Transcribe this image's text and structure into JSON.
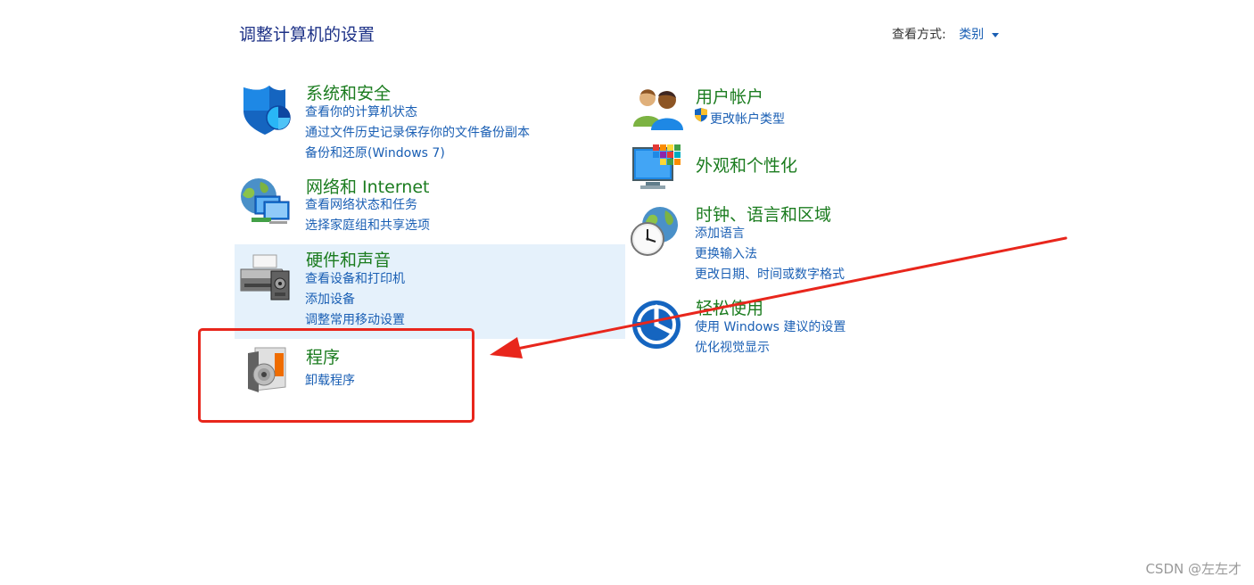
{
  "header": {
    "title": "调整计算机的设置",
    "view_by_label": "查看方式:",
    "view_by_value": "类别"
  },
  "categories": {
    "system_security": {
      "title": "系统和安全",
      "links": [
        "查看你的计算机状态",
        "通过文件历史记录保存你的文件备份副本",
        "备份和还原(Windows 7)"
      ]
    },
    "network": {
      "title": "网络和 Internet",
      "links": [
        "查看网络状态和任务",
        "选择家庭组和共享选项"
      ]
    },
    "hardware": {
      "title": "硬件和声音",
      "links": [
        "查看设备和打印机",
        "添加设备",
        "调整常用移动设置"
      ]
    },
    "programs": {
      "title": "程序",
      "links": [
        "卸载程序"
      ]
    },
    "user_accounts": {
      "title": "用户帐户",
      "links": [
        "更改帐户类型"
      ]
    },
    "appearance": {
      "title": "外观和个性化",
      "links": []
    },
    "clock_region": {
      "title": "时钟、语言和区域",
      "links": [
        "添加语言",
        "更换输入法",
        "更改日期、时间或数字格式"
      ]
    },
    "ease_of_access": {
      "title": "轻松使用",
      "links": [
        "使用 Windows 建议的设置",
        "优化视觉显示"
      ]
    }
  },
  "annotation": {
    "box_color": "#e8261c",
    "arrow_color": "#e8261c"
  },
  "watermark": "CSDN @左左才",
  "colors": {
    "category_title": "#1b7c1f",
    "link": "#1a5fb4",
    "page_title": "#1e3287",
    "hover_background": "#e5f1fb"
  }
}
